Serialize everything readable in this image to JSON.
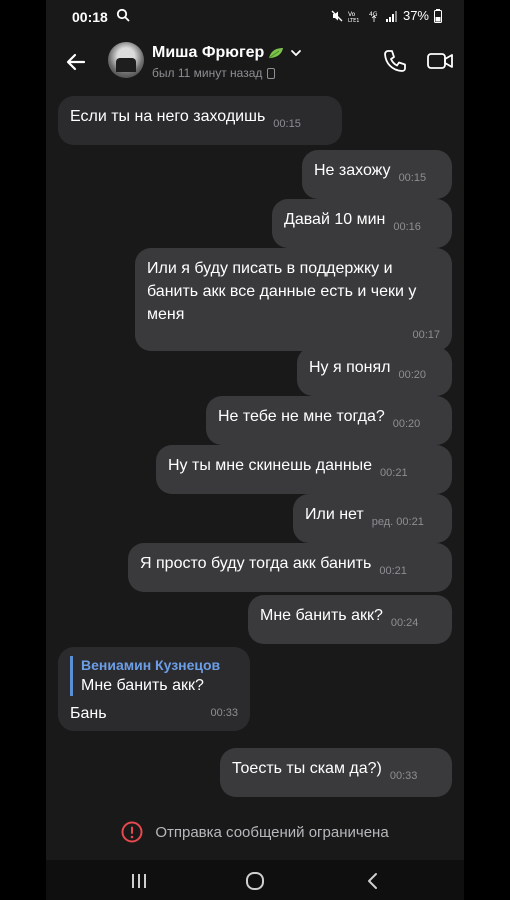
{
  "status": {
    "time": "00:18",
    "battery": "37%",
    "network": "4G"
  },
  "header": {
    "name": "Миша Фрюгер",
    "last_seen": "был 11 минут назад"
  },
  "messages": [
    {
      "dir": "in",
      "text": "Если ты на него заходишь",
      "time": "00:15"
    },
    {
      "dir": "out",
      "text": "Не захожу",
      "time": "00:15"
    },
    {
      "dir": "out",
      "text": "Давай 10 мин",
      "time": "00:16"
    },
    {
      "dir": "out",
      "text": "Или я буду писать в поддержку и банить акк все данные есть и чеки у меня",
      "time": "00:17"
    },
    {
      "dir": "out",
      "text": "Ну я понял",
      "time": "00:20"
    },
    {
      "dir": "out",
      "text": "Не тебе не мне тогда?",
      "time": "00:20"
    },
    {
      "dir": "out",
      "text": "Ну ты мне скинешь данные",
      "time": "00:21"
    },
    {
      "dir": "out",
      "text": "Или нет",
      "edited": "ред.",
      "time": "00:21"
    },
    {
      "dir": "out",
      "text": "Я просто буду тогда акк банить",
      "time": "00:21"
    },
    {
      "dir": "out",
      "text": "Мне банить акк?",
      "time": "00:24"
    },
    {
      "dir": "in",
      "reply_author": "Вениамин Кузнецов",
      "reply_text": "Мне банить акк?",
      "text": "Бань",
      "time": "00:33"
    },
    {
      "dir": "out",
      "text": "Тоесть ты скам да?)",
      "time": "00:33"
    }
  ],
  "notice": {
    "text": "Отправка сообщений ограничена"
  },
  "colors": {
    "background": "#19191a",
    "bubble_out": "#3a3a3c",
    "bubble_in": "#2b2b2d",
    "reply_accent": "#5b8fd6",
    "warning": "#e5484d"
  }
}
